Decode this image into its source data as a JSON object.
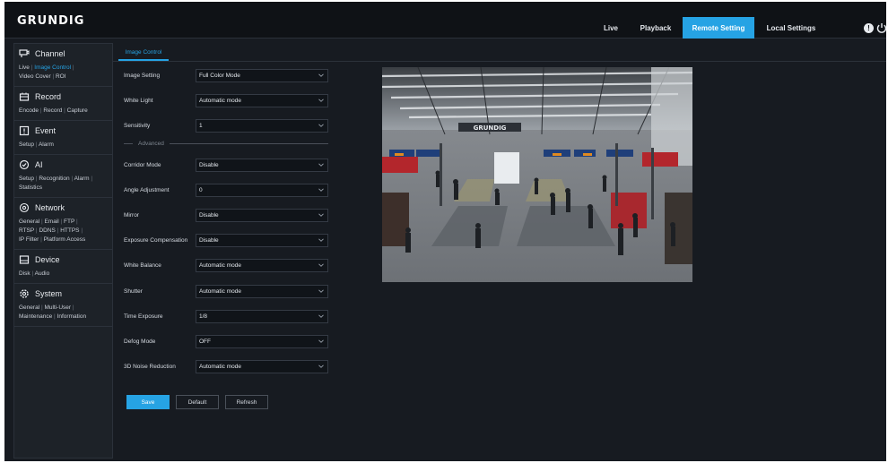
{
  "brand": "GRUNDIG",
  "nav": {
    "live": "Live",
    "playback": "Playback",
    "remote": "Remote Setting",
    "local": "Local Settings"
  },
  "colors": {
    "accent": "#26a3e4",
    "background": "#171b21",
    "topbar": "#0f1216"
  },
  "sidebar": {
    "channel": {
      "title": "Channel",
      "links": [
        "Live",
        "Image Control",
        "Video Cover",
        "ROI"
      ]
    },
    "record": {
      "title": "Record",
      "links": [
        "Encode",
        "Record",
        "Capture"
      ]
    },
    "event": {
      "title": "Event",
      "links": [
        "Setup",
        "Alarm"
      ]
    },
    "ai": {
      "title": "AI",
      "links": [
        "Setup",
        "Recognition",
        "Alarm",
        "Statistics"
      ]
    },
    "network": {
      "title": "Network",
      "links": [
        "General",
        "Email",
        "FTP",
        "RTSP",
        "DDNS",
        "HTTPS",
        "IP Filter",
        "Platform Access"
      ]
    },
    "device": {
      "title": "Device",
      "links": [
        "Disk",
        "Audio"
      ]
    },
    "system": {
      "title": "System",
      "links": [
        "General",
        "Multi-User",
        "Maintenance",
        "Information"
      ]
    }
  },
  "tab": "Image Control",
  "form": {
    "image_setting": {
      "label": "Image Setting",
      "value": "Full Color Mode"
    },
    "white_light": {
      "label": "White Light",
      "value": "Automatic mode"
    },
    "sensitivity": {
      "label": "Sensitivity",
      "value": "1"
    },
    "advanced": "Advanced",
    "corridor_mode": {
      "label": "Corridor Mode",
      "value": "Disable"
    },
    "angle_adjustment": {
      "label": "Angle Adjustment",
      "value": "0"
    },
    "mirror": {
      "label": "Mirror",
      "value": "Disable"
    },
    "exposure_compensation": {
      "label": "Exposure Compensation",
      "value": "Disable"
    },
    "white_balance": {
      "label": "White Balance",
      "value": "Automatic mode"
    },
    "shutter": {
      "label": "Shutter",
      "value": "Automatic mode"
    },
    "time_exposure": {
      "label": "Time Exposure",
      "value": "1/8"
    },
    "defog_mode": {
      "label": "Defog Mode",
      "value": "OFF"
    },
    "noise_reduction": {
      "label": "3D Noise Reduction",
      "value": "Automatic mode"
    }
  },
  "buttons": {
    "save": "Save",
    "default": "Default",
    "refresh": "Refresh"
  },
  "preview": {
    "sign_text": "GRUNDIG"
  }
}
